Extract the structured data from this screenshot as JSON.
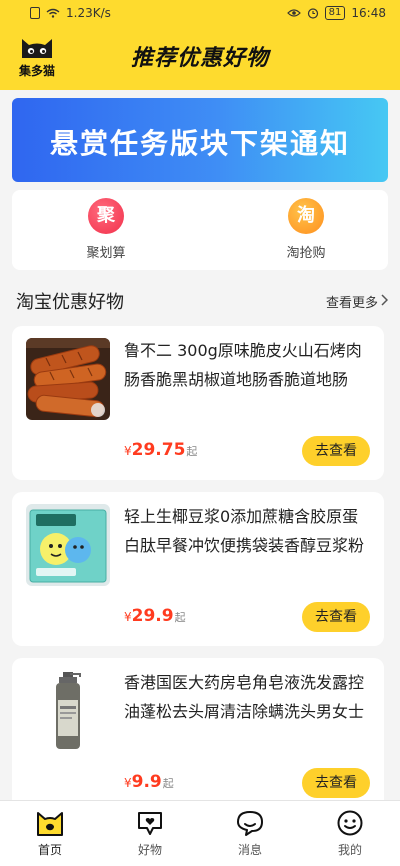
{
  "status_bar": {
    "network_speed": "1.23K/s",
    "battery": "81",
    "time": "16:48"
  },
  "header": {
    "logo_text": "集多猫",
    "title": "推荐优惠好物"
  },
  "banner": {
    "text": "悬赏任务版块下架通知"
  },
  "quick_links": [
    {
      "icon_char": "聚",
      "label": "聚划算",
      "color": "#f2304b"
    },
    {
      "icon_char": "淘",
      "label": "淘抢购",
      "color": "#ff8f1e"
    }
  ],
  "section": {
    "title": "淘宝优惠好物",
    "more": "查看更多"
  },
  "products": [
    {
      "title": "鲁不二 300g原味脆皮火山石烤肉肠香脆黑胡椒道地肠香脆道地肠",
      "currency": "¥",
      "price": "29.75",
      "suffix": "起",
      "button": "去查看"
    },
    {
      "title": "轻上生椰豆浆0添加蔗糖含胶原蛋白肽早餐冲饮便携袋装香醇豆浆粉",
      "currency": "¥",
      "price": "29.9",
      "suffix": "起",
      "button": "去查看"
    },
    {
      "title": "香港国医大药房皂角皂液洗发露控油蓬松去头屑清洁除螨洗头男女士",
      "currency": "¥",
      "price": "9.9",
      "suffix": "起",
      "button": "去查看"
    }
  ],
  "tabs": [
    {
      "label": "首页",
      "icon": "cat-home-icon",
      "active": true
    },
    {
      "label": "好物",
      "icon": "heart-bubble-icon",
      "active": false
    },
    {
      "label": "消息",
      "icon": "message-bubble-icon",
      "active": false
    },
    {
      "label": "我的",
      "icon": "smiley-icon",
      "active": false
    }
  ],
  "colors": {
    "brand_yellow": "#fedb2e",
    "button_yellow": "#fed02b",
    "price_red": "#ff3b1f"
  }
}
